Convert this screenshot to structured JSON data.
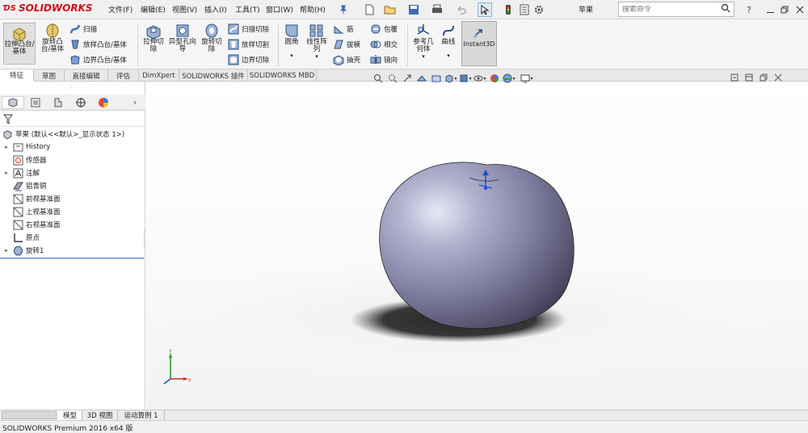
{
  "app": {
    "logo_text": "SOLIDWORKS",
    "doc_title": "苹果"
  },
  "menu": [
    "文件(F)",
    "编辑(E)",
    "视图(V)",
    "插入(I)",
    "工具(T)",
    "窗口(W)",
    "帮助(H)"
  ],
  "search": {
    "placeholder": "搜索命令"
  },
  "commands": {
    "extrude_boss": "拉伸凸台/基体",
    "revolve_boss": "旋转凸台/基体",
    "sweep": "扫描",
    "loft_boss": "放样凸台/基体",
    "boundary_boss": "边界凸台/基体",
    "extrude_cut": "拉伸切除",
    "hole_wizard": "异型孔向导",
    "revolve_cut": "旋转切除",
    "swept_cut": "扫描切除",
    "lofted_cut": "放样切割",
    "boundary_cut": "边界切除",
    "fillet": "圆角",
    "linear_pattern": "线性阵列",
    "rib": "筋",
    "draft": "拔模",
    "shell": "抽壳",
    "wrap": "包覆",
    "intersect": "相交",
    "mirror": "镜向",
    "ref_geometry": "参考几何体",
    "curves": "曲线",
    "instant3d": "Instant3D"
  },
  "tabs": [
    "特征",
    "草图",
    "直接编辑",
    "评估",
    "DimXpert",
    "SOLIDWORKS 插件",
    "SOLIDWORKS MBD"
  ],
  "tree": {
    "root": "苹果  (默认<<默认>_显示状态 1>)",
    "items": [
      {
        "label": "History",
        "expandable": true
      },
      {
        "label": "传感器",
        "expandable": false
      },
      {
        "label": "注解",
        "expandable": true
      },
      {
        "label": "铝青铜",
        "expandable": false
      },
      {
        "label": "前视基准面",
        "expandable": false
      },
      {
        "label": "上视基准面",
        "expandable": false
      },
      {
        "label": "右视基准面",
        "expandable": false
      },
      {
        "label": "原点",
        "expandable": false
      },
      {
        "label": "旋转1",
        "expandable": true
      }
    ]
  },
  "bottom_tabs": [
    "模型",
    "3D 视图",
    "运动算例 1"
  ],
  "status": "SOLIDWORKS Premium 2016 x64 版",
  "colors": {
    "accent": "#d0101a",
    "selection": "#1f6bd1",
    "model": "#7c7b9e"
  }
}
